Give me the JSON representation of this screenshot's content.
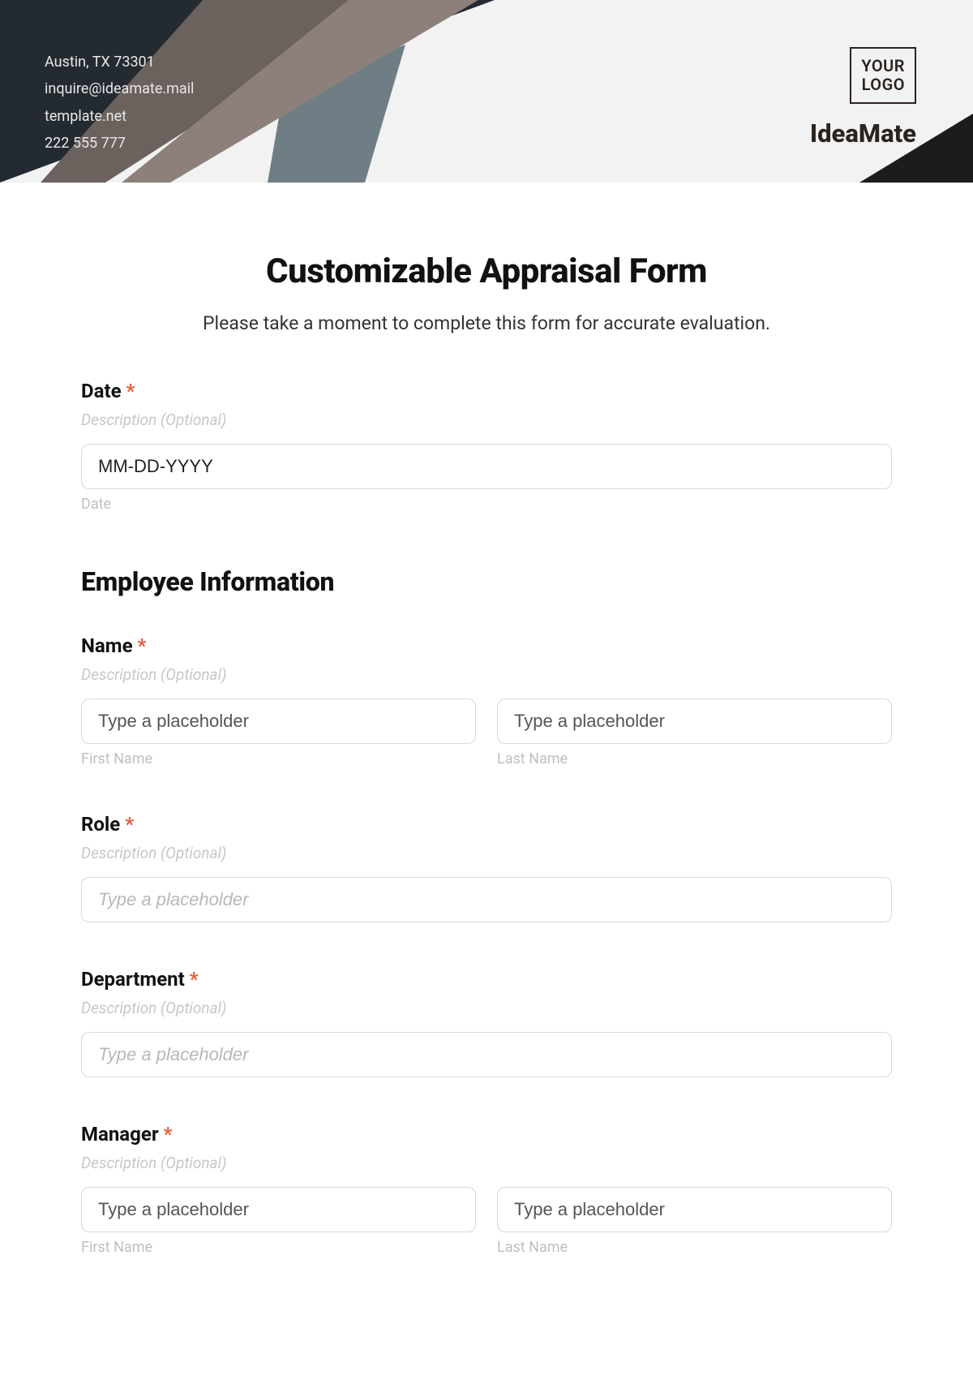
{
  "header": {
    "contact": {
      "address": "Austin, TX 73301",
      "email": "inquire@ideamate.mail",
      "website": "template.net",
      "phone": "222 555 777"
    },
    "logo_line1": "YOUR",
    "logo_line2": "LOGO",
    "brand": "IdeaMate"
  },
  "form": {
    "title": "Customizable Appraisal Form",
    "subtitle": "Please take a moment to complete this form for accurate evaluation.",
    "required_mark": "*",
    "desc_optional": "Description (Optional)",
    "date": {
      "label": "Date",
      "placeholder": "MM-DD-YYYY",
      "sub": "Date"
    },
    "section_employee": "Employee Information",
    "name": {
      "label": "Name",
      "first_ph": "Type a placeholder",
      "last_ph": "Type a placeholder",
      "first_sub": "First Name",
      "last_sub": "Last Name"
    },
    "role": {
      "label": "Role",
      "placeholder": "Type a placeholder"
    },
    "department": {
      "label": "Department",
      "placeholder": "Type a placeholder"
    },
    "manager": {
      "label": "Manager",
      "first_ph": "Type a placeholder",
      "last_ph": "Type a placeholder",
      "first_sub": "First Name",
      "last_sub": "Last Name"
    }
  }
}
